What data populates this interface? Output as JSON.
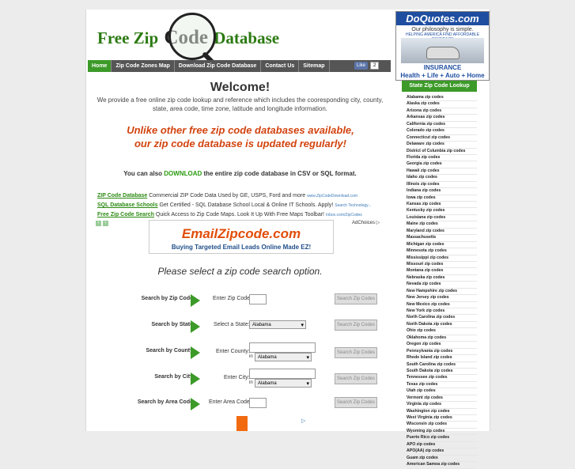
{
  "logo": {
    "part1": "Free Zip",
    "part2": "Code",
    "part3": "Database"
  },
  "top_ad": {
    "title": "DoQuotes.com",
    "slogan": "Our philosophy is simple.",
    "tagline": "HELPING AMERICA FIND AFFORDABLE COVERAGE",
    "line1": "INSURANCE",
    "line2": "Health + Life + Auto + Home"
  },
  "nav": [
    "Home",
    "Zip Code Zones Map",
    "Download Zip Code Database",
    "Contact Us",
    "Sitemap"
  ],
  "facebook": {
    "label": "Like",
    "count": "2"
  },
  "welcome": "Welcome!",
  "intro": "We provide a free online zip code lookup and reference which includes the cooresponding city, county, state, area code, time zone, latitude and longitude information.",
  "promo_line1": "Unlike other free zip code databases available,",
  "promo_line2": "our zip code database is updated regularly!",
  "download": {
    "pre": "You can also ",
    "link": "DOWNLOAD",
    "post": " the entire zip code database in CSV or SQL format."
  },
  "text_ads": [
    {
      "title": "ZIP Code Database",
      "text": " Commercial ZIP Code Data Used by GE, USPS, Ford and more ",
      "url": "www.ZipCodeDownload.com"
    },
    {
      "title": "SQL Database Schools",
      "text": " Get Certified - SQL Database School Local & Online IT Schools. Apply! ",
      "url": "Search Technology..."
    },
    {
      "title": "Free Zip Code Search",
      "text": " Quick Access to Zip Code Maps. Look It Up With Free Maps Toolbar! ",
      "url": "Inbox.com/ZipCodes"
    }
  ],
  "adchoices": "AdChoices ▷",
  "banner": {
    "title": "EmailZipcode.com",
    "subtitle": "Buying Targeted Email Leads Online Made EZ!"
  },
  "prompt": "Please select a zip code search option.",
  "search_rows": [
    {
      "label": "Search by Zip Code",
      "field_label": "Enter Zip Code:",
      "button": "Search Zip Codes"
    },
    {
      "label": "Search by State",
      "field_label": "Select a State:",
      "select": "Alabama",
      "button": "Search Zip Codes"
    },
    {
      "label": "Search by County",
      "field_label": "Enter County:",
      "in": "in",
      "select": "Alabama",
      "button": "Search Zip Codes"
    },
    {
      "label": "Search by City",
      "field_label": "Enter City:",
      "in": "in",
      "select": "Alabama",
      "button": "Search Zip Codes"
    },
    {
      "label": "Search by Area Code",
      "field_label": "Enter Area Code:",
      "button": "Search Zip Codes"
    }
  ],
  "sidebar": {
    "title": "State Zip Code Lookup",
    "items": [
      "Alabama zip codes",
      "Alaska zip codes",
      "Arizona zip codes",
      "Arkansas zip codes",
      "California zip codes",
      "Colorado zip codes",
      "Connecticut zip codes",
      "Delaware zip codes",
      "District of Columbia zip codes",
      "Florida zip codes",
      "Georgia zip codes",
      "Hawaii zip codes",
      "Idaho zip codes",
      "Illinois zip codes",
      "Indiana zip codes",
      "Iowa zip codes",
      "Kansas zip codes",
      "Kentucky zip codes",
      "Louisiana zip codes",
      "Maine zip codes",
      "Maryland zip codes",
      "Massachusetts",
      "Michigan zip codes",
      "Minnesota zip codes",
      "Mississippi zip codes",
      "Missouri zip codes",
      "Montana zip codes",
      "Nebraska zip codes",
      "Nevada zip codes",
      "New Hampshire zip codes",
      "New Jersey zip codes",
      "New Mexico zip codes",
      "New York zip codes",
      "North Carolina zip codes",
      "North Dakota zip codes",
      "Ohio zip codes",
      "Oklahoma zip codes",
      "Oregon zip codes",
      "Pennsylvania zip codes",
      "Rhode Island zip codes",
      "South Carolina zip codes",
      "South Dakota zip codes",
      "Tennessee zip codes",
      "Texas zip codes",
      "Utah zip codes",
      "Vermont zip codes",
      "Virginia zip codes",
      "Washington zip codes",
      "West Virginia zip codes",
      "Wisconsin zip codes",
      "Wyoming zip codes",
      "Puerto Rico zip codes",
      "APO zip codes",
      "APO(AA) zip codes",
      "Guam zip codes",
      "American Samoa zip codes"
    ]
  }
}
